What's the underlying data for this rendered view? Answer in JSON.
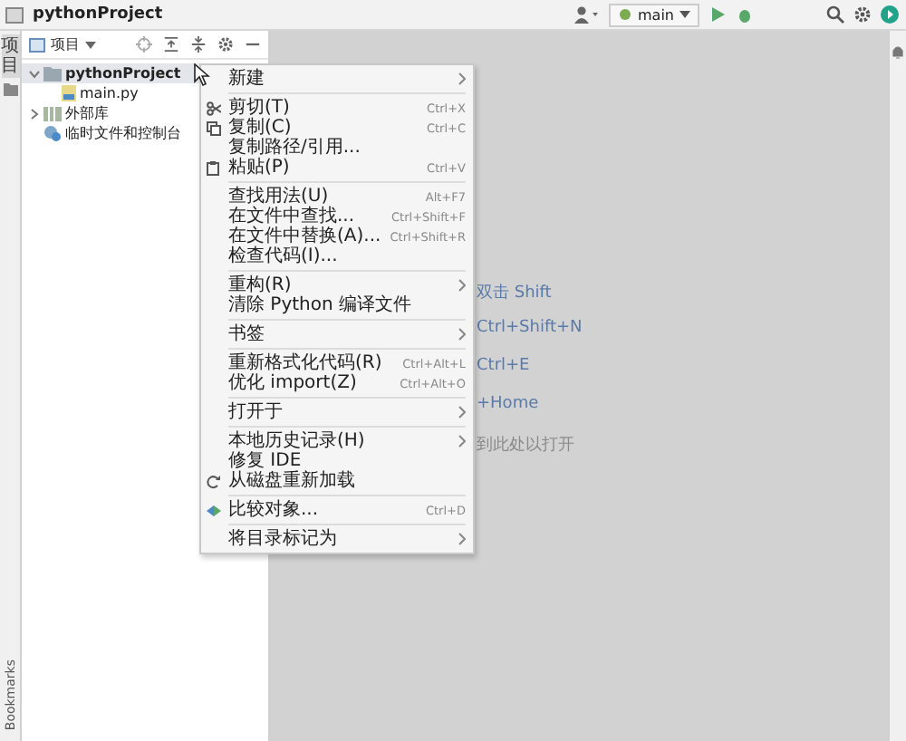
{
  "window": {
    "title": "pythonProject"
  },
  "toolbar": {
    "branch": "main"
  },
  "left_strip": {
    "tabs": [
      {
        "label": "项目",
        "selected": true
      },
      {
        "label": "Bookmarks",
        "selected": false
      }
    ]
  },
  "project_panel": {
    "view": "项目",
    "tree": [
      {
        "label": "pythonProject",
        "kind": "folder",
        "selected": true,
        "expanded": true,
        "children": [
          {
            "label": "main.py",
            "kind": "file",
            "selected": false
          }
        ]
      },
      {
        "label": "外部库",
        "kind": "library",
        "selected": false,
        "expanded": false
      },
      {
        "label": "临时文件和控制台",
        "kind": "scratch",
        "selected": false
      }
    ]
  },
  "context_menu": {
    "items": [
      {
        "kind": "item",
        "label": "新建",
        "submenu": true
      },
      {
        "kind": "separator"
      },
      {
        "kind": "cut",
        "label": "剪切(T)",
        "shortcut": "Ctrl+X"
      },
      {
        "kind": "copy",
        "label": "复制(C)",
        "shortcut": "Ctrl+C"
      },
      {
        "kind": "item",
        "label": "复制路径/引用..."
      },
      {
        "kind": "paste",
        "label": "粘贴(P)",
        "shortcut": "Ctrl+V"
      },
      {
        "kind": "separator"
      },
      {
        "kind": "item",
        "label": "查找用法(U)",
        "shortcut": "Alt+F7"
      },
      {
        "kind": "item",
        "label": "在文件中查找...",
        "shortcut": "Ctrl+Shift+F"
      },
      {
        "kind": "item",
        "label": "在文件中替换(A)...",
        "shortcut": "Ctrl+Shift+R"
      },
      {
        "kind": "item",
        "label": "检查代码(I)..."
      },
      {
        "kind": "separator"
      },
      {
        "kind": "item",
        "label": "重构(R)",
        "submenu": true
      },
      {
        "kind": "item",
        "label": "清除 Python 编译文件"
      },
      {
        "kind": "separator"
      },
      {
        "kind": "item",
        "label": "书签",
        "submenu": true
      },
      {
        "kind": "separator"
      },
      {
        "kind": "item",
        "label": "重新格式化代码(R)",
        "shortcut": "Ctrl+Alt+L"
      },
      {
        "kind": "item",
        "label": "优化 import(Z)",
        "shortcut": "Ctrl+Alt+O"
      },
      {
        "kind": "separator"
      },
      {
        "kind": "item",
        "label": "打开于",
        "submenu": true
      },
      {
        "kind": "separator"
      },
      {
        "kind": "item",
        "label": "本地历史记录(H)",
        "submenu": true
      },
      {
        "kind": "item",
        "label": "修复 IDE"
      },
      {
        "kind": "reload",
        "label": "从磁盘重新加载"
      },
      {
        "kind": "separator"
      },
      {
        "kind": "compare",
        "label": "比较对象...",
        "shortcut": "Ctrl+D"
      },
      {
        "kind": "separator"
      },
      {
        "kind": "item",
        "label": "将目录标记为",
        "submenu": true
      }
    ]
  },
  "editor_hints": [
    {
      "text": "双击 Shift",
      "kind": "shortcut"
    },
    {
      "text": "Ctrl+Shift+N",
      "kind": "shortcut"
    },
    {
      "text": "Ctrl+E",
      "kind": "shortcut"
    },
    {
      "text": "+Home",
      "kind": "shortcut"
    },
    {
      "text": "到此处以打开",
      "kind": "note"
    }
  ]
}
